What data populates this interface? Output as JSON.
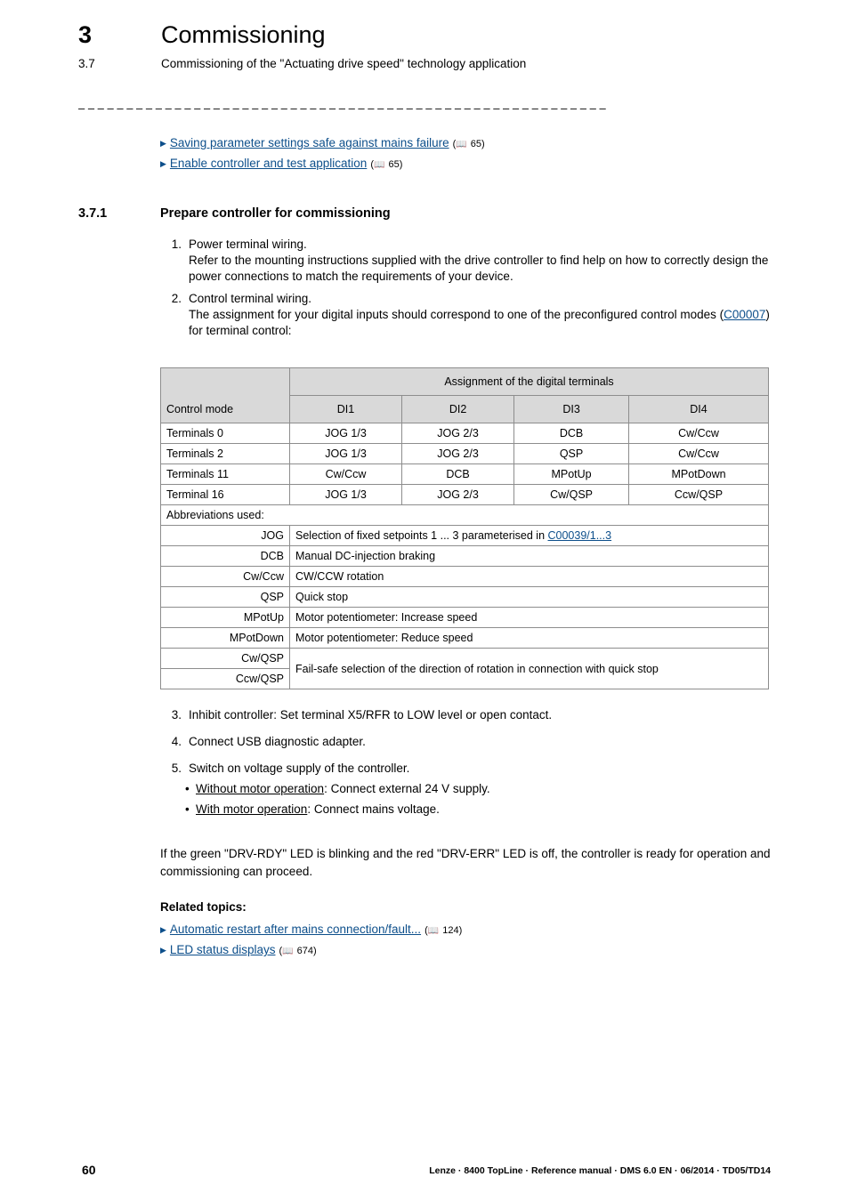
{
  "header": {
    "chapter_num": "3",
    "chapter_title": "Commissioning",
    "section_num": "3.7",
    "section_title": "Commissioning of the \"Actuating drive speed\" technology application",
    "divider": "– – – – – – – – – – – – – – – – – – – – – – – – – – – – – – – – – – – – – – – – – – – – – – – – – – – – – – –"
  },
  "xrefs": [
    {
      "icon": "triangle-right-icon",
      "label": "Saving parameter settings safe against mains failure",
      "page_icon": "book-icon",
      "page": "65"
    },
    {
      "icon": "triangle-right-icon",
      "label": "Enable controller and test application",
      "page_icon": "book-icon",
      "page": "65"
    }
  ],
  "subhead": {
    "num": "3.7.1",
    "title": "Prepare controller for commissioning"
  },
  "steps": [
    {
      "num": "1.",
      "title": "Power terminal wiring.",
      "body": "Refer to the mounting instructions supplied with the drive controller to find help on how to correctly design the power connections to match the requirements of your device."
    },
    {
      "num": "2.",
      "title": "Control terminal wiring.",
      "body_pre": "The assignment for your digital inputs should correspond to one of the preconfigured control modes (",
      "link": "C00007",
      "body_post": ") for terminal control:"
    }
  ],
  "table": {
    "group_header": "Assignment of the digital terminals",
    "columns": [
      "Control mode",
      "DI1",
      "DI2",
      "DI3",
      "DI4"
    ],
    "rows": [
      [
        "Terminals 0",
        "JOG 1/3",
        "JOG 2/3",
        "DCB",
        "Cw/Ccw"
      ],
      [
        "Terminals 2",
        "JOG 1/3",
        "JOG 2/3",
        "QSP",
        "Cw/Ccw"
      ],
      [
        "Terminals 11",
        "Cw/Ccw",
        "DCB",
        "MPotUp",
        "MPotDown"
      ],
      [
        "Terminal 16",
        "JOG 1/3",
        "JOG 2/3",
        "Cw/QSP",
        "Ccw/QSP"
      ]
    ],
    "abbr_title": "Abbreviations used:",
    "abbreviations": [
      {
        "key": "JOG",
        "value_pre": "Selection of fixed setpoints 1 ... 3 parameterised in ",
        "link": "C00039/1...3",
        "value_post": ""
      },
      {
        "key": "DCB",
        "value_pre": "Manual DC-injection braking",
        "link": "",
        "value_post": ""
      },
      {
        "key": "Cw/Ccw",
        "value_pre": "CW/CCW rotation",
        "link": "",
        "value_post": ""
      },
      {
        "key": "QSP",
        "value_pre": "Quick stop",
        "link": "",
        "value_post": ""
      },
      {
        "key": "MPotUp",
        "value_pre": "Motor potentiometer: Increase speed",
        "link": "",
        "value_post": ""
      },
      {
        "key": "MPotDown",
        "value_pre": "Motor potentiometer: Reduce speed",
        "link": "",
        "value_post": ""
      },
      {
        "key": "Cw/QSP",
        "value_pre": "Fail-safe selection of the direction of rotation in connection with quick stop",
        "link": "",
        "value_post": ""
      },
      {
        "key": "Ccw/QSP",
        "value_pre": "",
        "link": "",
        "value_post": ""
      }
    ]
  },
  "steps2": [
    {
      "num": "3.",
      "text": "Inhibit controller: Set terminal X5/RFR to LOW level or open contact."
    },
    {
      "num": "4.",
      "text": "Connect USB diagnostic adapter."
    },
    {
      "num": "5.",
      "text": "Switch on voltage supply of the controller."
    }
  ],
  "bullets": [
    {
      "underlined": "Without motor operation",
      "rest": ": Connect external 24 V supply."
    },
    {
      "underlined": "With motor operation",
      "rest": ": Connect mains voltage."
    }
  ],
  "paragraph": "If the green \"DRV-RDY\" LED is blinking and the red \"DRV-ERR\" LED is off, the controller is ready for operation and commissioning can proceed.",
  "related": {
    "title": "Related topics:",
    "items": [
      {
        "icon": "triangle-right-icon",
        "label": "Automatic restart after mains connection/fault...",
        "page_icon": "book-icon",
        "page": "124"
      },
      {
        "icon": "triangle-right-icon",
        "label": "LED status displays",
        "page_icon": "book-icon",
        "page": "674"
      }
    ]
  },
  "footer": {
    "page_number": "60",
    "text": "Lenze · 8400 TopLine · Reference manual · DMS 6.0 EN · 06/2014 · TD05/TD14"
  }
}
